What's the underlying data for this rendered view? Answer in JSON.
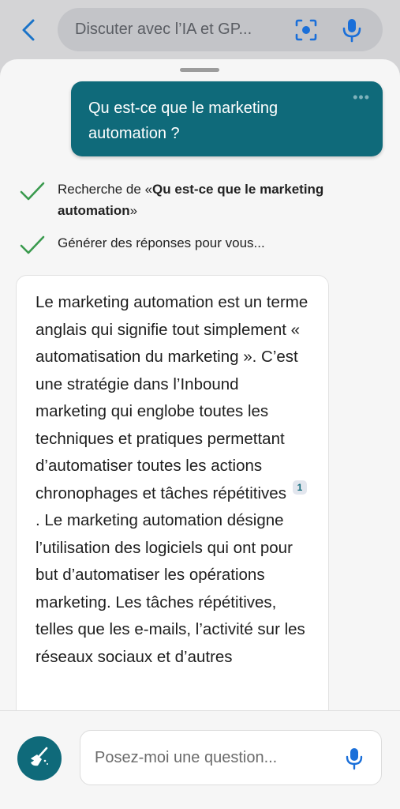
{
  "header": {
    "search_text": "Discuter avec l’IA et GP...",
    "back_icon": "back-arrow-icon",
    "scan_icon": "visual-search-icon",
    "mic_icon": "microphone-icon"
  },
  "chat": {
    "user_message": "Qu est-ce que le marketing automation ?",
    "more_options": "•••",
    "steps": [
      {
        "prefix": "Recherche de «",
        "query": "Qu est-ce que le marketing automation",
        "suffix": "»"
      },
      {
        "text": "Générer des réponses pour vous..."
      }
    ],
    "answer_before_cite": "Le marketing automation est un terme anglais qui signifie tout simplement « automatisation du marketing ». C’est une stratégie dans l’Inbound marketing qui englobe toutes les techniques et pratiques permettant d’automatiser toutes les actions chronophages et tâches répétitives",
    "citation": "1",
    "answer_after_cite": ". Le marketing automation désigne l’utilisation des logiciels qui ont pour but d’automatiser les opérations marketing. Les tâches répétitives, telles que les e-mails, l’activité sur les réseaux sociaux et d’autres"
  },
  "composer": {
    "placeholder": "Posez-moi une question...",
    "sweep_icon": "broom-icon",
    "mic_icon": "microphone-icon"
  },
  "colors": {
    "accent": "#0f6a7a",
    "check": "#3a9a4e",
    "back_arrow": "#1a73c8",
    "mic": "#1a6fd9"
  }
}
